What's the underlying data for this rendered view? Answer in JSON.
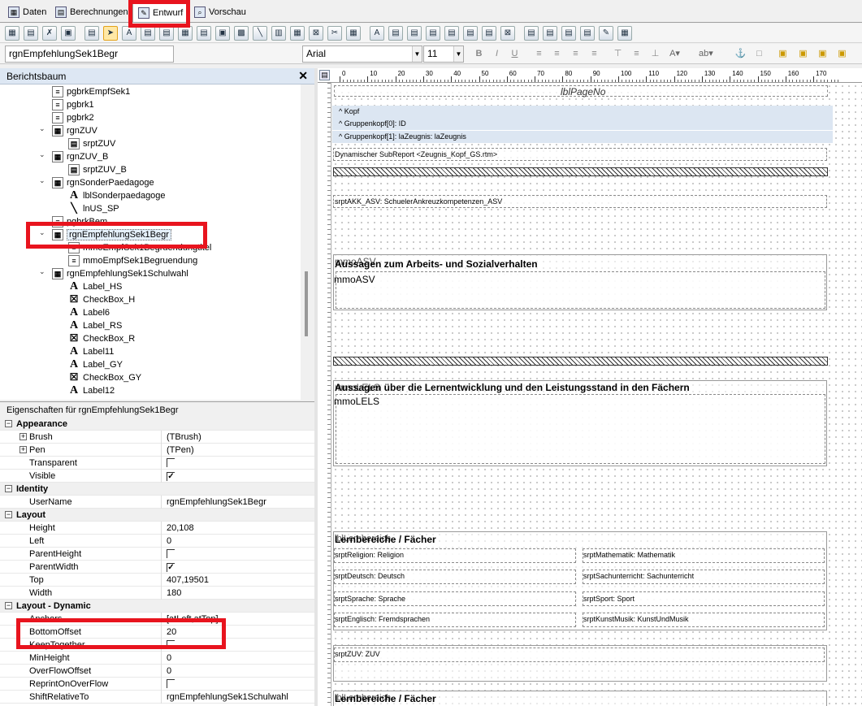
{
  "tabs": [
    {
      "label": "Daten",
      "icon": "table-icon"
    },
    {
      "label": "Berechnungen",
      "icon": "calculator-icon"
    },
    {
      "label": "Entwurf",
      "icon": "pencil-icon",
      "active": true
    },
    {
      "label": "Vorschau",
      "icon": "preview-icon"
    }
  ],
  "format": {
    "component": "rgnEmpfehlungSek1Begr",
    "font": "Arial",
    "size": "11"
  },
  "tree": {
    "title": "Berichtsbaum",
    "close": "✕",
    "items": [
      {
        "label": "pgbrkEmpfSek1",
        "icon": "page-break-icon",
        "indent": 2
      },
      {
        "label": "pgbrk1",
        "icon": "page-break-icon",
        "indent": 2
      },
      {
        "label": "pgbrk2",
        "icon": "page-break-icon",
        "indent": 2
      },
      {
        "label": "rgnZUV",
        "icon": "region-icon",
        "indent": 2,
        "expanded": true
      },
      {
        "label": "srptZUV",
        "icon": "subreport-icon",
        "indent": 3
      },
      {
        "label": "rgnZUV_B",
        "icon": "region-icon",
        "indent": 2,
        "expanded": true
      },
      {
        "label": "srptZUV_B",
        "icon": "subreport-icon",
        "indent": 3
      },
      {
        "label": "rgnSonderPaedagoge",
        "icon": "region-icon",
        "indent": 2,
        "expanded": true
      },
      {
        "label": "lblSonderpaedagoge",
        "icon": "label-icon",
        "indent": 3
      },
      {
        "label": "lnUS_SP",
        "icon": "line-icon",
        "indent": 3
      },
      {
        "label": "pgbrkBem",
        "icon": "page-break-icon",
        "indent": 2
      },
      {
        "label": "rgnEmpfehlungSek1Begr",
        "icon": "region-icon",
        "indent": 2,
        "expanded": true,
        "selected": true
      },
      {
        "label": "mmoEmpfSek1Begruendungtitel",
        "icon": "memo-icon",
        "indent": 3
      },
      {
        "label": "mmoEmpfSek1Begruendung",
        "icon": "memo-icon",
        "indent": 3
      },
      {
        "label": "rgnEmpfehlungSek1Schulwahl",
        "icon": "region-icon",
        "indent": 2,
        "expanded": true
      },
      {
        "label": "Label_HS",
        "icon": "label-icon",
        "indent": 3
      },
      {
        "label": "CheckBox_H",
        "icon": "checkbox-icon",
        "indent": 3
      },
      {
        "label": "Label6",
        "icon": "label-icon",
        "indent": 3
      },
      {
        "label": "Label_RS",
        "icon": "label-icon",
        "indent": 3
      },
      {
        "label": "CheckBox_R",
        "icon": "checkbox-icon",
        "indent": 3
      },
      {
        "label": "Label11",
        "icon": "label-icon",
        "indent": 3
      },
      {
        "label": "Label_GY",
        "icon": "label-icon",
        "indent": 3
      },
      {
        "label": "CheckBox_GY",
        "icon": "checkbox-icon",
        "indent": 3
      },
      {
        "label": "Label12",
        "icon": "label-icon",
        "indent": 3
      }
    ]
  },
  "props": {
    "title": "Eigenschaften für rgnEmpfehlungSek1Begr",
    "rows": [
      {
        "cat": "Appearance"
      },
      {
        "name": "Brush",
        "value": "(TBrush)",
        "expand": true
      },
      {
        "name": "Pen",
        "value": "(TPen)",
        "expand": true
      },
      {
        "name": "Transparent",
        "check": false
      },
      {
        "name": "Visible",
        "check": true
      },
      {
        "cat": "Identity"
      },
      {
        "name": "UserName",
        "value": "rgnEmpfehlungSek1Begr"
      },
      {
        "cat": "Layout"
      },
      {
        "name": "Height",
        "value": "20,108"
      },
      {
        "name": "Left",
        "value": "0"
      },
      {
        "name": "ParentHeight",
        "check": false
      },
      {
        "name": "ParentWidth",
        "check": true
      },
      {
        "name": "Top",
        "value": "407,19501"
      },
      {
        "name": "Width",
        "value": "180"
      },
      {
        "cat": "Layout - Dynamic"
      },
      {
        "name": "Anchors",
        "value": "[atLeft,atTop]"
      },
      {
        "name": "BottomOffset",
        "value": "20"
      },
      {
        "name": "KeepTogether",
        "check": false
      },
      {
        "name": "MinHeight",
        "value": "0"
      },
      {
        "name": "OverFlowOffset",
        "value": "0"
      },
      {
        "name": "ReprintOnOverFlow",
        "check": false
      },
      {
        "name": "ShiftRelativeTo",
        "value": "rgnEmpfehlungSek1Schulwahl"
      }
    ]
  },
  "ruler": [
    "0",
    "10",
    "20",
    "30",
    "40",
    "50",
    "60",
    "70",
    "80",
    "90",
    "100",
    "110",
    "120",
    "130",
    "140",
    "150",
    "160",
    "170"
  ],
  "design": {
    "pageno": "lblPageNo",
    "bands": [
      "^  Kopf",
      "^  Gruppenkopf[0]: ID",
      "^  Gruppenkopf[1]: laZeugnis: laZeugnis"
    ],
    "subreport_kopf": "Dynamischer SubReport <Zeugnis_Kopf_GS.rtm>",
    "srpt_akk": "srptAKK_ASV: SchuelerAnkreuzkompetenzen_ASV",
    "asv_title": "Aussagen zum Arbeits- und Sozialverhalten",
    "asv_under": "mmoASV",
    "asv_memo": "mmoASV",
    "lels_title": "Aussagen über die Lernentwicklung und den Leistungsstand in den Fächern",
    "lels_under": "mmoLELS",
    "lels_memo": "mmoLELS",
    "lb_title": "Lernbereiche / Fächer",
    "lb_under": "lblLernbereich",
    "subs_left": [
      "srptReligion: Religion",
      "srptDeutsch: Deutsch",
      "srptSprache: Sprache",
      "srptEnglisch: Fremdsprachen"
    ],
    "subs_right": [
      "srptMathematik: Mathematik",
      "srptSachunterricht: Sachunterricht",
      "srptSport: Sport",
      "srptKunstMusik: KunstUndMusik"
    ],
    "zuv": "srptZUV: ZUV",
    "lb2_title": "Lernbereiche / Fächer",
    "lb2_under": "lblLernbereich"
  },
  "highlight_color": "#e8141e"
}
